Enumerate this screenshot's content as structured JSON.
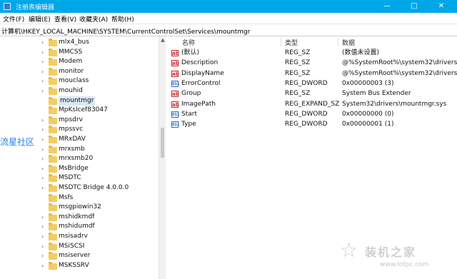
{
  "window": {
    "title": "注册表编辑器",
    "controls": {
      "minimize": "—",
      "maximize": "□",
      "close": "✕"
    }
  },
  "menu": [
    "文件(F)",
    "编辑(E)",
    "查看(V)",
    "收藏夹(A)",
    "帮助(H)"
  ],
  "address": "计算机\\HKEY_LOCAL_MACHINE\\SYSTEM\\CurrentControlSet\\Services\\mountmgr",
  "tree": {
    "items": [
      {
        "label": "mlx4_bus",
        "expandable": true
      },
      {
        "label": "MMCSS",
        "expandable": true
      },
      {
        "label": "Modem",
        "expandable": true
      },
      {
        "label": "monitor",
        "expandable": true
      },
      {
        "label": "mouclass",
        "expandable": true
      },
      {
        "label": "mouhid",
        "expandable": true
      },
      {
        "label": "mountmgr",
        "expandable": false,
        "selected": true
      },
      {
        "label": "MpKslcef83047",
        "expandable": false
      },
      {
        "label": "mpsdrv",
        "expandable": true
      },
      {
        "label": "mpssvc",
        "expandable": true
      },
      {
        "label": "MRxDAV",
        "expandable": true
      },
      {
        "label": "mrxsmb",
        "expandable": true
      },
      {
        "label": "mrxsmb20",
        "expandable": true
      },
      {
        "label": "MsBridge",
        "expandable": true
      },
      {
        "label": "MSDTC",
        "expandable": true
      },
      {
        "label": "MSDTC Bridge 4.0.0.0",
        "expandable": true
      },
      {
        "label": "Msfs",
        "expandable": false
      },
      {
        "label": "msgpiowin32",
        "expandable": false
      },
      {
        "label": "mshidkmdf",
        "expandable": true
      },
      {
        "label": "mshidumdf",
        "expandable": true
      },
      {
        "label": "msisadrv",
        "expandable": true
      },
      {
        "label": "MSiSCSI",
        "expandable": true
      },
      {
        "label": "msiserver",
        "expandable": true
      },
      {
        "label": "MSKSSRV",
        "expandable": true
      }
    ]
  },
  "details": {
    "headers": {
      "name": "名称",
      "type": "类型",
      "data": "数据"
    },
    "rows": [
      {
        "icon": "string-value-icon",
        "name": "(默认)",
        "type": "REG_SZ",
        "data": "(数值未设置)"
      },
      {
        "icon": "string-value-icon",
        "name": "Description",
        "type": "REG_SZ",
        "data": "@%SystemRoot%\\system32\\drivers\\moun"
      },
      {
        "icon": "string-value-icon",
        "name": "DisplayName",
        "type": "REG_SZ",
        "data": "@%SystemRoot%\\system32\\drivers\\moun"
      },
      {
        "icon": "dword-value-icon",
        "name": "ErrorControl",
        "type": "REG_DWORD",
        "data": "0x00000003 (3)"
      },
      {
        "icon": "string-value-icon",
        "name": "Group",
        "type": "REG_SZ",
        "data": "System Bus Extender"
      },
      {
        "icon": "string-value-icon",
        "name": "ImagePath",
        "type": "REG_EXPAND_SZ",
        "data": "System32\\drivers\\mountmgr.sys"
      },
      {
        "icon": "dword-value-icon",
        "name": "Start",
        "type": "REG_DWORD",
        "data": "0x00000000 (0)"
      },
      {
        "icon": "dword-value-icon",
        "name": "Type",
        "type": "REG_DWORD",
        "data": "0x00000001 (1)"
      }
    ]
  },
  "watermarks": {
    "left": "流星社区",
    "right_title": "装机之家",
    "right_url": "www.lotpc.com"
  },
  "colors": {
    "titlebar": "#00a7e8",
    "selection": "#d9e7f5",
    "folder": "#f2cd62"
  }
}
